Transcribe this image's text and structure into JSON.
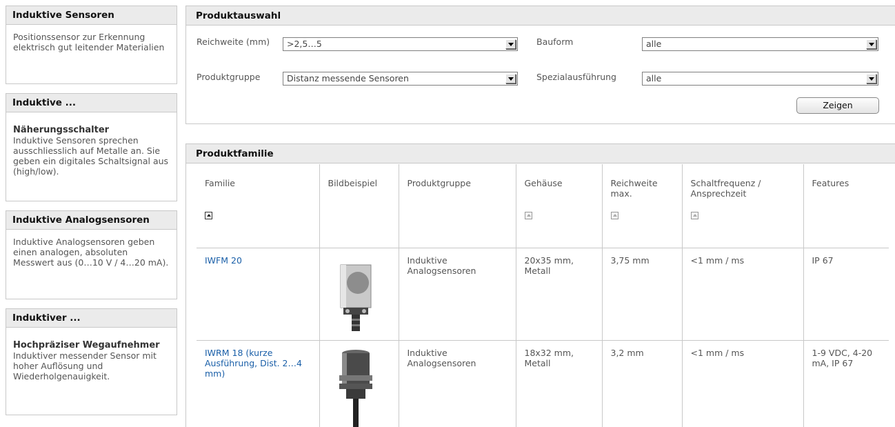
{
  "sidebar": {
    "boxes": [
      {
        "title": "Induktive Sensoren",
        "sub": "",
        "text": "Positionssensor zur Erkennung elektrisch gut leitender Materialien"
      },
      {
        "title": "Induktive ...",
        "sub": "Näherungsschalter",
        "text": "Induktive Sensoren sprechen ausschliesslich auf Metalle an. Sie geben ein digitales Schaltsignal aus (high/low)."
      },
      {
        "title": "Induktive Analogsensoren",
        "sub": "",
        "text": "Induktive Analogsensoren geben einen analogen, absoluten Messwert aus (0…10 V / 4…20 mA)."
      },
      {
        "title": "Induktiver ...",
        "sub": "Hochpräziser Wegaufnehmer",
        "text": "Induktiver messender Sensor mit hoher Auflösung und Wiederholgenauigkeit."
      }
    ]
  },
  "selection": {
    "title": "Produktauswahl",
    "reichweite_label": "Reichweite (mm)",
    "reichweite_value": ">2,5…5",
    "bauform_label": "Bauform",
    "bauform_value": "alle",
    "produktgruppe_label": "Produktgruppe",
    "produktgruppe_value": "Distanz messende Sensoren",
    "spezial_label": "Spezialausführung",
    "spezial_value": "alle",
    "show_button": "Zeigen"
  },
  "family": {
    "title": "Produktfamilie",
    "columns": [
      "Familie",
      "Bildbeispiel",
      "Produktgruppe",
      "Gehäuse",
      "Reichweite max.",
      "Schaltfrequenz / Ansprechzeit",
      "Features"
    ],
    "rows": [
      {
        "familie": "IWFM 20",
        "produktgruppe": "Induktive Analogsensoren",
        "gehaeuse": "20x35 mm, Metall",
        "reichweite": "3,75 mm",
        "schaltfrequenz": "<1 mm / ms",
        "features": "IP 67"
      },
      {
        "familie": "IWRM 18 (kurze Ausführung, Dist. 2…4 mm)",
        "produktgruppe": "Induktive Analogsensoren",
        "gehaeuse": "18x32 mm, Metall",
        "reichweite": "3,2 mm",
        "schaltfrequenz": "<1 mm / ms",
        "features": "1-9 VDC, 4-20 mA, IP 67"
      }
    ]
  }
}
